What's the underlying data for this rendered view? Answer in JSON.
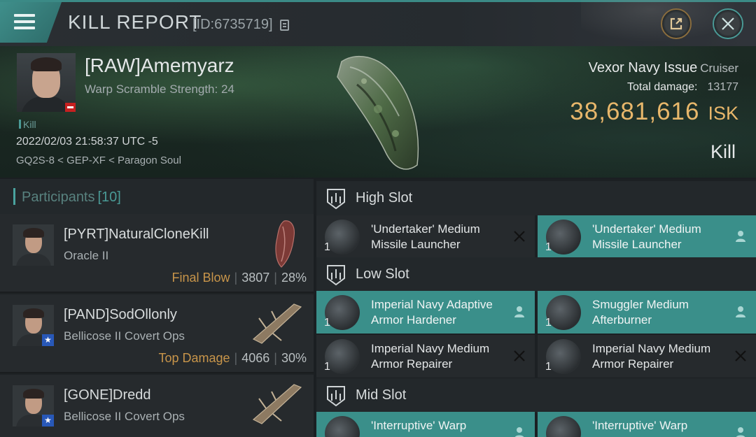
{
  "header": {
    "title": "KILL REPORT",
    "kill_id": "[ID:6735719]"
  },
  "victim": {
    "name": "[RAW]Amemyarz",
    "warp_scramble": "Warp Scramble Strength: 24",
    "kill_tag": "Kill",
    "date": "2022/02/03 21:58:37 UTC -5",
    "location": "GQ2S-8 < GEP-XF < Paragon Soul",
    "ship_name": "Vexor Navy Issue",
    "ship_class": "Cruiser",
    "total_damage_label": "Total damage:",
    "total_damage": "13177",
    "isk_value": "38,681,616",
    "isk_unit": "ISK",
    "result": "Kill"
  },
  "participants": {
    "title": "Participants",
    "count": "[10]",
    "list": [
      {
        "name": "[PYRT]NaturalCloneKill",
        "ship": "Oracle II",
        "role": "Final Blow",
        "damage": "3807",
        "percent": "28%"
      },
      {
        "name": "[PAND]SodOllonly",
        "ship": "Bellicose II Covert Ops",
        "role": "Top Damage",
        "damage": "4066",
        "percent": "30%"
      },
      {
        "name": "[GONE]Dredd",
        "ship": "Bellicose II Covert Ops",
        "role": "",
        "damage": "",
        "percent": ""
      }
    ]
  },
  "fitting": {
    "high_slot_title": "High Slot",
    "low_slot_title": "Low Slot",
    "mid_slot_title": "Mid Slot",
    "high": [
      {
        "name": "'Undertaker' Medium Missile Launcher",
        "qty": "1",
        "status": "destroyed"
      },
      {
        "name": "'Undertaker' Medium Missile Launcher",
        "qty": "1",
        "status": "dropped"
      }
    ],
    "low": [
      {
        "name": "Imperial Navy Adaptive Armor Hardener",
        "qty": "1",
        "status": "dropped"
      },
      {
        "name": "Smuggler Medium Afterburner",
        "qty": "1",
        "status": "dropped"
      },
      {
        "name": "Imperial Navy Medium Armor Repairer",
        "qty": "1",
        "status": "destroyed"
      },
      {
        "name": "Imperial Navy Medium Armor Repairer",
        "qty": "1",
        "status": "destroyed"
      }
    ],
    "mid": [
      {
        "name": "'Interruptive' Warp",
        "qty": "1",
        "status": "dropped"
      },
      {
        "name": "'Interruptive' Warp",
        "qty": "1",
        "status": "dropped"
      }
    ]
  },
  "colors": {
    "accent": "#3b8a86",
    "isk": "#e8b76b",
    "role": "#c8954a",
    "dropped": "#3a8f8a"
  },
  "icons": [
    "menu-icon",
    "copy-icon",
    "share-icon",
    "close-icon",
    "slot-icon",
    "person-icon",
    "x-icon"
  ]
}
